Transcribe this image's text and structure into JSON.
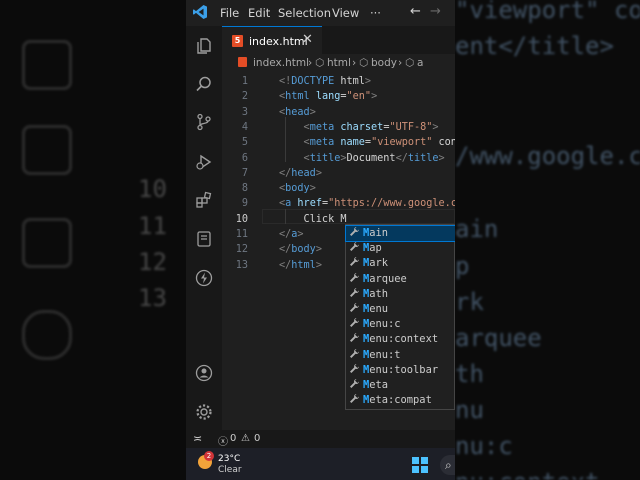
{
  "background": {
    "line_numbers": [
      "10",
      "11",
      "12",
      "13"
    ],
    "code_lines": [
      "\"viewport\" con",
      "ent</title>",
      "/www.google.c",
      "ain",
      "p",
      "rk",
      "arquee",
      "th",
      "nu",
      "nu:c",
      "nu:context"
    ]
  },
  "titlebar": {
    "menu": [
      "File",
      "Edit",
      "Selection",
      "View"
    ],
    "more": "···",
    "back": "←",
    "forward": "→"
  },
  "tab": {
    "label": "index.html",
    "close": "✕",
    "file_type_badge": "5"
  },
  "breadcrumb": {
    "file": "index.html",
    "sep": "›",
    "items": [
      "html",
      "body",
      "a"
    ]
  },
  "editor": {
    "line_numbers": [
      "1",
      "2",
      "3",
      "4",
      "5",
      "6",
      "7",
      "8",
      "9",
      "10",
      "11",
      "12",
      "13"
    ],
    "current_line": "10",
    "lines": [
      "<!DOCTYPE html>",
      "<html lang=\"en\">",
      "<head>",
      "    <meta charset=\"UTF-8\">",
      "    <meta name=\"viewport\" con",
      "    <title>Document</title>",
      "</head>",
      "<body>",
      "<a href=\"https://www.google.c",
      "    Click M",
      "</a>",
      "</body>",
      "</html>"
    ]
  },
  "suggestions": {
    "typed": "M",
    "items": [
      "Main",
      "Map",
      "Mark",
      "Marquee",
      "Math",
      "Menu",
      "Menu:c",
      "Menu:context",
      "Menu:t",
      "Menu:toolbar",
      "Meta",
      "Meta:compat"
    ],
    "selected_index": 0
  },
  "statusbar": {
    "errors": "0",
    "warnings": "0"
  },
  "taskbar": {
    "weather_badge": "2",
    "temperature": "23°C",
    "condition": "Clear"
  },
  "activity_bar": {
    "settings_badge": "1"
  }
}
